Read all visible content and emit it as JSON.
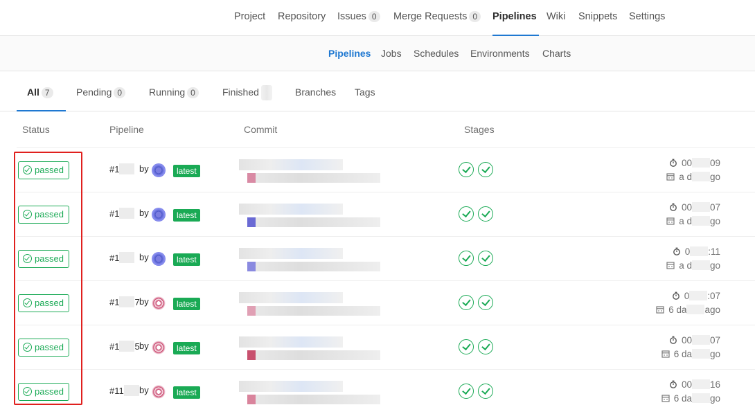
{
  "top_nav": {
    "items": [
      {
        "label": "Project"
      },
      {
        "label": "Repository"
      },
      {
        "label": "Issues",
        "count": "0"
      },
      {
        "label": "Merge Requests",
        "count": "0"
      },
      {
        "label": "Pipelines",
        "active": true
      },
      {
        "label": "Wiki"
      },
      {
        "label": "Snippets"
      },
      {
        "label": "Settings"
      }
    ]
  },
  "sub_nav": {
    "items": [
      {
        "label": "Pipelines",
        "active": true
      },
      {
        "label": "Jobs"
      },
      {
        "label": "Schedules"
      },
      {
        "label": "Environments"
      },
      {
        "label": "Charts"
      }
    ]
  },
  "scope_tabs": {
    "items": [
      {
        "label": "All",
        "count": "7",
        "active": true
      },
      {
        "label": "Pending",
        "count": "0"
      },
      {
        "label": "Running",
        "count": "0"
      },
      {
        "label": "Finished"
      },
      {
        "label": "Branches"
      },
      {
        "label": "Tags"
      }
    ]
  },
  "table": {
    "headers": {
      "status": "Status",
      "pipeline": "Pipeline",
      "commit": "Commit",
      "stages": "Stages"
    },
    "rows": [
      {
        "status": "passed",
        "id_prefix": "#1",
        "id_suffix": "",
        "by": "by",
        "tag": "latest",
        "duration_prefix": "00",
        "duration_suffix": "09",
        "finished_prefix": "a d",
        "finished_suffix": "go"
      },
      {
        "status": "passed",
        "id_prefix": "#1",
        "id_suffix": "",
        "by": "by",
        "tag": "latest",
        "duration_prefix": "00",
        "duration_suffix": "07",
        "finished_prefix": "a d",
        "finished_suffix": "go"
      },
      {
        "status": "passed",
        "id_prefix": "#1",
        "id_suffix": "",
        "by": "by",
        "tag": "latest",
        "duration_prefix": "0",
        "duration_suffix": ":11",
        "finished_prefix": "a d",
        "finished_suffix": "go"
      },
      {
        "status": "passed",
        "id_prefix": "#1",
        "id_suffix": "7",
        "by": "by",
        "tag": "latest",
        "duration_prefix": "0",
        "duration_suffix": ":07",
        "finished_prefix": "6 da",
        "finished_suffix": "ago"
      },
      {
        "status": "passed",
        "id_prefix": "#1",
        "id_suffix": "5",
        "by": "by",
        "tag": "latest",
        "duration_prefix": "00",
        "duration_suffix": "07",
        "finished_prefix": "6 da",
        "finished_suffix": "go"
      },
      {
        "status": "passed",
        "id_prefix": "#11",
        "id_suffix": "",
        "by": "by",
        "tag": "latest",
        "duration_prefix": "00",
        "duration_suffix": "16",
        "finished_prefix": "6 da",
        "finished_suffix": "go"
      }
    ]
  },
  "colors": {
    "accent": "#1f78d1",
    "success": "#1aaa55",
    "highlight": "#e0201e"
  },
  "icons": {
    "stage": "check-circle-icon",
    "duration": "stopwatch-icon",
    "finished": "calendar-icon",
    "status": "check-circle-icon"
  }
}
